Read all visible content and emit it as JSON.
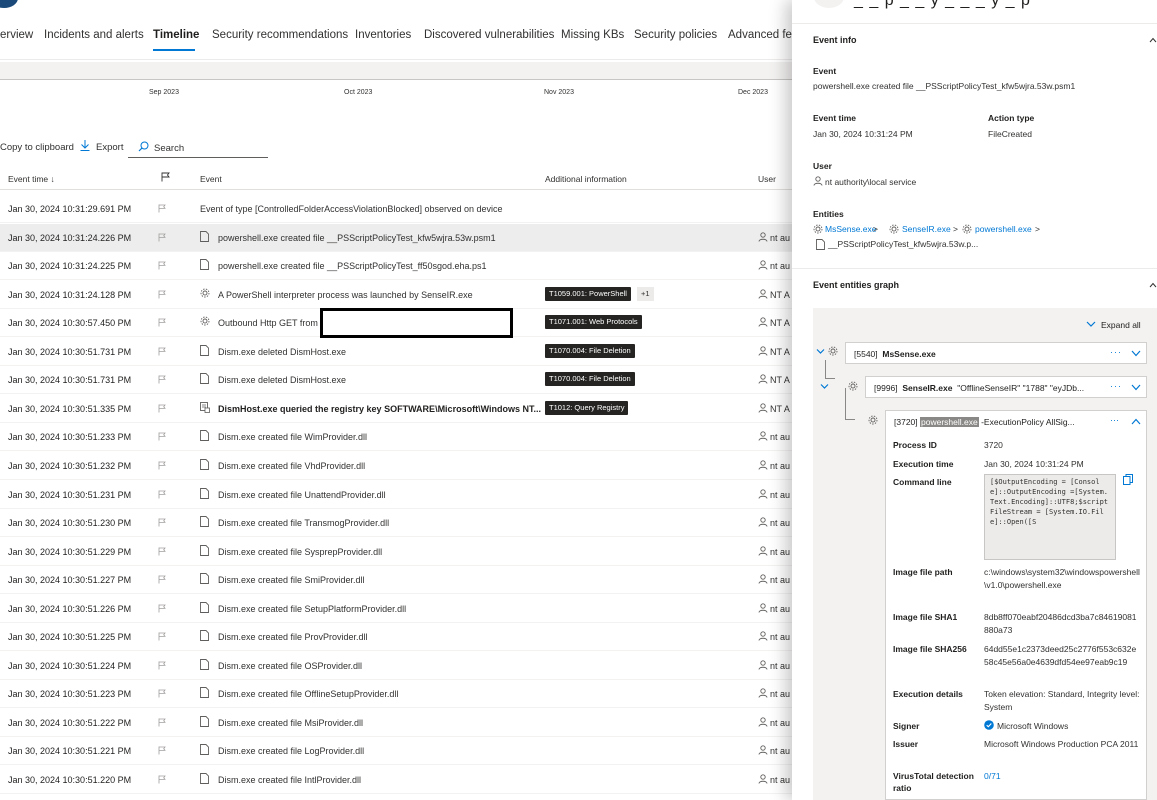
{
  "tabs": [
    "erview",
    "Incidents and alerts",
    "Timeline",
    "Security recommendations",
    "Inventories",
    "Discovered vulnerabilities",
    "Missing KBs",
    "Security policies",
    "Advanced fea"
  ],
  "active_tab": "Timeline",
  "timeline_months": [
    "Sep 2023",
    "Oct 2023",
    "Nov 2023",
    "Dec 2023"
  ],
  "toolbar": {
    "copy_label": "Copy to clipboard",
    "export_label": "Export",
    "search_placeholder": "Search"
  },
  "columns": {
    "event_time": "Event time ↓",
    "event": "Event",
    "additional": "Additional information",
    "user": "User"
  },
  "rows": [
    {
      "time": "Jan 30, 2024 10:31:29.691 PM",
      "event": "Event of type [ControlledFolderAccessViolationBlocked] observed on device",
      "icon": "none",
      "tag": "",
      "plus": "",
      "user": ""
    },
    {
      "time": "Jan 30, 2024 10:31:24.226 PM",
      "event": "powershell.exe created file __PSScriptPolicyTest_kfw5wjra.53w.psm1",
      "icon": "file",
      "tag": "",
      "plus": "",
      "user": "nt au",
      "selected": true
    },
    {
      "time": "Jan 30, 2024 10:31:24.225 PM",
      "event": "powershell.exe created file __PSScriptPolicyTest_ff50sgod.eha.ps1",
      "icon": "file",
      "tag": "",
      "plus": "",
      "user": "nt au"
    },
    {
      "time": "Jan 30, 2024 10:31:24.128 PM",
      "event": "A PowerShell interpreter process was launched by SenseIR.exe",
      "icon": "gear",
      "tag": "T1059.001: PowerShell",
      "plus": "+1",
      "user": "NT A"
    },
    {
      "time": "Jan 30, 2024 10:30:57.450 PM",
      "event": "Outbound Http GET from",
      "icon": "gear",
      "tag": "T1071.001: Web Protocols",
      "plus": "",
      "user": "NT A"
    },
    {
      "time": "Jan 30, 2024 10:30:51.731 PM",
      "event": "Dism.exe deleted DismHost.exe",
      "icon": "file",
      "tag": "T1070.004: File Deletion",
      "plus": "",
      "user": "NT A"
    },
    {
      "time": "Jan 30, 2024 10:30:51.731 PM",
      "event": "Dism.exe deleted DismHost.exe",
      "icon": "file",
      "tag": "T1070.004: File Deletion",
      "plus": "",
      "user": "NT A"
    },
    {
      "time": "Jan 30, 2024 10:30:51.335 PM",
      "event": "DismHost.exe queried the registry key SOFTWARE\\Microsoft\\Windows NT...",
      "icon": "registry",
      "tag": "T1012: Query Registry",
      "plus": "",
      "user": "NT A",
      "bold": true
    },
    {
      "time": "Jan 30, 2024 10:30:51.233 PM",
      "event": "Dism.exe created file WimProvider.dll",
      "icon": "file",
      "tag": "",
      "plus": "",
      "user": "nt au"
    },
    {
      "time": "Jan 30, 2024 10:30:51.232 PM",
      "event": "Dism.exe created file VhdProvider.dll",
      "icon": "file",
      "tag": "",
      "plus": "",
      "user": "nt au"
    },
    {
      "time": "Jan 30, 2024 10:30:51.231 PM",
      "event": "Dism.exe created file UnattendProvider.dll",
      "icon": "file",
      "tag": "",
      "plus": "",
      "user": "nt au"
    },
    {
      "time": "Jan 30, 2024 10:30:51.230 PM",
      "event": "Dism.exe created file TransmogProvider.dll",
      "icon": "file",
      "tag": "",
      "plus": "",
      "user": "nt au"
    },
    {
      "time": "Jan 30, 2024 10:30:51.229 PM",
      "event": "Dism.exe created file SysprepProvider.dll",
      "icon": "file",
      "tag": "",
      "plus": "",
      "user": "nt au"
    },
    {
      "time": "Jan 30, 2024 10:30:51.227 PM",
      "event": "Dism.exe created file SmiProvider.dll",
      "icon": "file",
      "tag": "",
      "plus": "",
      "user": "nt au"
    },
    {
      "time": "Jan 30, 2024 10:30:51.226 PM",
      "event": "Dism.exe created file SetupPlatformProvider.dll",
      "icon": "file",
      "tag": "",
      "plus": "",
      "user": "nt au"
    },
    {
      "time": "Jan 30, 2024 10:30:51.225 PM",
      "event": "Dism.exe created file ProvProvider.dll",
      "icon": "file",
      "tag": "",
      "plus": "",
      "user": "nt au"
    },
    {
      "time": "Jan 30, 2024 10:30:51.224 PM",
      "event": "Dism.exe created file OSProvider.dll",
      "icon": "file",
      "tag": "",
      "plus": "",
      "user": "nt au"
    },
    {
      "time": "Jan 30, 2024 10:30:51.223 PM",
      "event": "Dism.exe created file OfflineSetupProvider.dll",
      "icon": "file",
      "tag": "",
      "plus": "",
      "user": "nt au"
    },
    {
      "time": "Jan 30, 2024 10:30:51.222 PM",
      "event": "Dism.exe created file MsiProvider.dll",
      "icon": "file",
      "tag": "",
      "plus": "",
      "user": "nt au"
    },
    {
      "time": "Jan 30, 2024 10:30:51.221 PM",
      "event": "Dism.exe created file LogProvider.dll",
      "icon": "file",
      "tag": "",
      "plus": "",
      "user": "nt au"
    },
    {
      "time": "Jan 30, 2024 10:30:51.220 PM",
      "event": "Dism.exe created file IntlProvider.dll",
      "icon": "file",
      "tag": "",
      "plus": "",
      "user": "nt au"
    }
  ],
  "panel": {
    "title": "_ _ p _ _ y _ _ _ y _ p",
    "event_info_title": "Event info",
    "event_label": "Event",
    "event_value": "powershell.exe created file __PSScriptPolicyTest_kfw5wjra.53w.psm1",
    "event_time_label": "Event time",
    "event_time_value": "Jan 30, 2024 10:31:24 PM",
    "action_type_label": "Action type",
    "action_type_value": "FileCreated",
    "user_label": "User",
    "user_value": "nt authority\\local service",
    "entities_label": "Entities",
    "entity_1": "MsSense.exe",
    "entity_2": "SenseIR.exe",
    "entity_3": "powershell.exe",
    "entity_sep": ">",
    "entity_file": "__PSScriptPolicyTest_kfw5wjra.53w.p...",
    "graph_title": "Event entities graph",
    "expand_all": "Expand all",
    "node1_pid": "[5540]",
    "node1_name": "MsSense.exe",
    "node2_pid": "[9996]",
    "node2_name": "SenseIR.exe",
    "node2_args": "\"OfflineSenseIR\" \"1788\" \"eyJDb...",
    "node3_pid": "[3720]",
    "node3_name": "powershell.exe",
    "node3_args": "-ExecutionPolicy AllSig...",
    "dots": "···",
    "details": {
      "process_id_label": "Process ID",
      "process_id_value": "3720",
      "exec_time_label": "Execution time",
      "exec_time_value": "Jan 30, 2024 10:31:24 PM",
      "cmd_label": "Command line",
      "cmd_value": "[$OutputEncoding = [Console]::OutputEncoding =[System.Text.Encoding]::UTF8;$scriptFileStream = [System.IO.File]::Open([S",
      "image_path_label": "Image file path",
      "image_path_value": "c:\\windows\\system32\\windowspowershell\\v1.0\\powershell.exe",
      "sha1_label": "Image file SHA1",
      "sha1_value": "8db8ff070eabf20486dcd3ba7c84619081880a73",
      "sha256_label": "Image file SHA256",
      "sha256_value": "64dd55e1c2373deed25c2776f553c632e58c45e56a0e4639dfd54ee97eab9c19",
      "exec_details_label": "Execution details",
      "exec_details_value": "Token elevation: Standard, Integrity level: System",
      "signer_label": "Signer",
      "signer_value": "Microsoft Windows",
      "issuer_label": "Issuer",
      "issuer_value": "Microsoft Windows Production PCA 2011",
      "vt_label": "VirusTotal detection ratio",
      "vt_value": "0/71"
    }
  },
  "colors": {
    "accent": "#0078d4",
    "tag_bg": "#252423",
    "selected_row": "#ededed"
  }
}
